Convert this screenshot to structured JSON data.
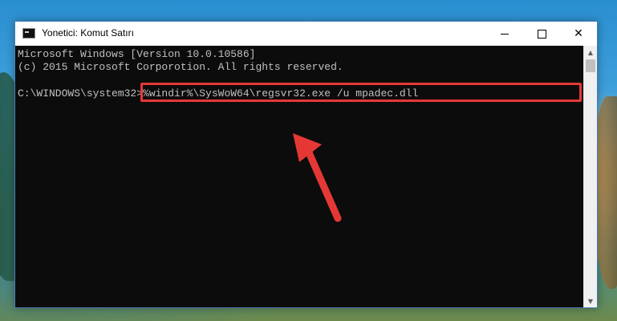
{
  "window": {
    "title": "Yonetici: Komut Satırı"
  },
  "console": {
    "lines": [
      "Microsoft Windows [Version 10.0.10586]",
      "(c) 2015 Microsoft Corporotion. All rights reserved."
    ],
    "prompt": "C:\\WINDOWS\\system32>",
    "command": "%windir%\\SysWoW64\\regsvr32.exe /u mpadec.dll"
  },
  "colors": {
    "highlight": "#e53935",
    "console_bg": "#0c0c0c",
    "console_text": "#c0c0c0"
  },
  "icons": {
    "app": "console-icon",
    "minimize": "minimize-icon",
    "maximize": "maximize-icon",
    "close": "close-icon",
    "annotation": "red-arrow-icon"
  }
}
